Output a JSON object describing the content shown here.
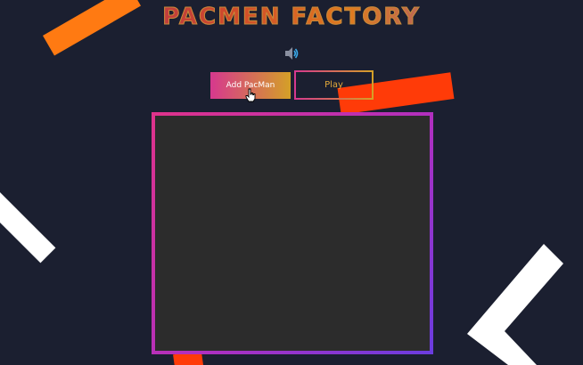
{
  "app": {
    "title": "PACMEN FACTORY"
  },
  "controls": {
    "add_label": "Add PacMan",
    "play_label": "Play"
  },
  "icons": {
    "sound": "speaker-icon",
    "cursor": "hand-pointer-icon"
  },
  "colors": {
    "background": "#1b1f30",
    "accent_pink": "#d6388e",
    "accent_gold": "#d4a027",
    "accent_orange": "#ff7a12",
    "accent_red": "#ff3b08",
    "canvas": "#2c2c2c",
    "frame_purple": "#6a3ce0"
  }
}
